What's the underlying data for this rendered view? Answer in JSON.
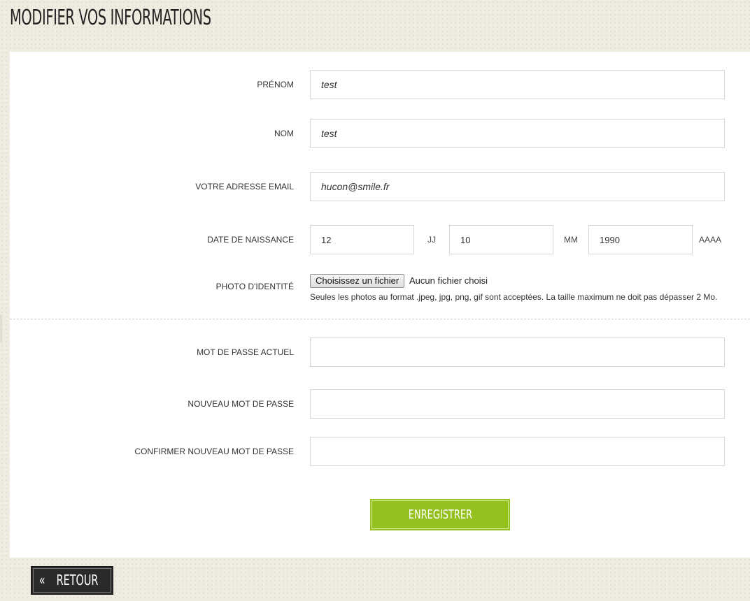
{
  "page": {
    "title": "Modifier vos informations"
  },
  "profile": {
    "firstname": {
      "label": "Prénom",
      "value": "test"
    },
    "lastname": {
      "label": "Nom",
      "value": "test"
    },
    "email": {
      "label": "Votre adresse email",
      "value": "hucon@smile.fr"
    },
    "birthdate": {
      "label": "Date de naissance",
      "day": "12",
      "day_unit": "JJ",
      "month": "10",
      "month_unit": "MM",
      "year": "1990",
      "year_unit": "AAAA"
    },
    "photo": {
      "label": "Photo d'identité",
      "button": "Choisissez un fichier",
      "status": "Aucun fichier choisi",
      "hint": "Seules les photos au format .jpeg, jpg, png, gif sont acceptées. La taille maximum ne doit pas dépasser 2 Mo."
    }
  },
  "password": {
    "current": {
      "label": "Mot de passe actuel",
      "value": ""
    },
    "new": {
      "label": "Nouveau mot de passe",
      "value": ""
    },
    "confirm": {
      "label": "Confirmer nouveau mot de passe",
      "value": ""
    }
  },
  "actions": {
    "save": "Enregistrer",
    "back_icon": "«",
    "back": "Retour"
  },
  "colors": {
    "accent": "#94c11f",
    "dark_button": "#2a2a2a",
    "background": "#eeebe0"
  }
}
